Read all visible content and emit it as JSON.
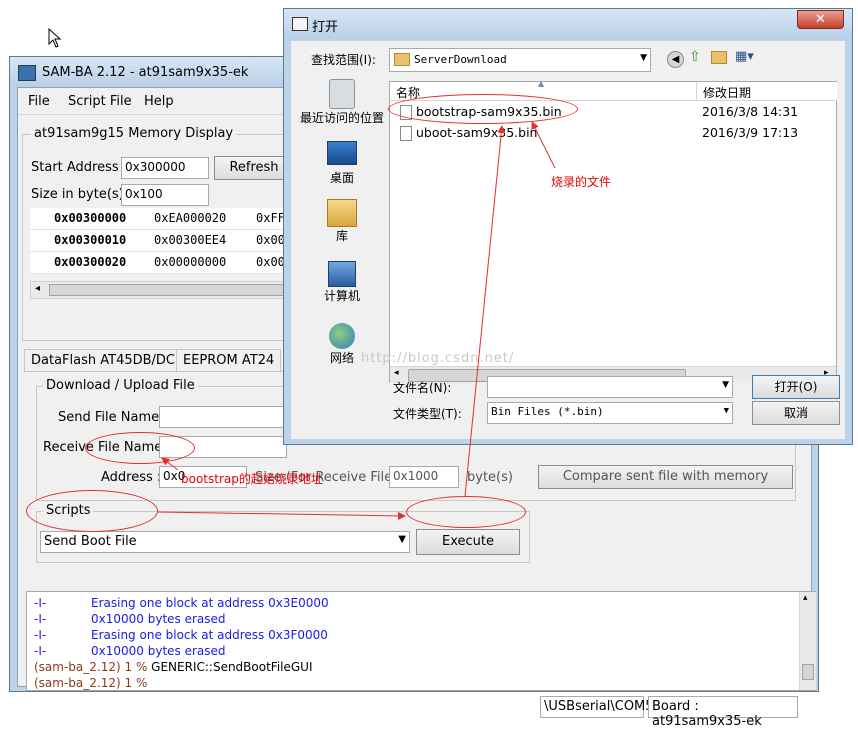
{
  "samba": {
    "title": "SAM-BA 2.12  - at91sam9x35-ek",
    "menu": [
      "File",
      "Script File",
      "Help"
    ],
    "memory_display": {
      "title": "at91sam9g15 Memory Display",
      "start_address_label": "Start Address :",
      "start_address_value": "0x300000",
      "refresh_label": "Refresh",
      "size_label": "Size in byte(s) :",
      "size_value": "0x100",
      "rows": [
        {
          "addr": "0x00300000",
          "v1": "0xEA000020",
          "v2": "0xFF"
        },
        {
          "addr": "0x00300010",
          "v1": "0x00300EE4",
          "v2": "0x00"
        },
        {
          "addr": "0x00300020",
          "v1": "0x00000000",
          "v2": "0x00"
        }
      ]
    },
    "tabs": [
      "DataFlash AT45DB/DCB",
      "EEPROM AT24"
    ],
    "download": {
      "title": "Download / Upload File",
      "send_file_label": "Send File Name :",
      "receive_file_label": "Receive File Name :",
      "address_label": "Address :",
      "address_value": "0x0",
      "size_label": "Size (For Receive File) :",
      "size_value": "0x1000",
      "size_unit": "byte(s)",
      "compare_label": "Compare sent file with memory"
    },
    "scripts": {
      "title": "Scripts",
      "selected": "Send Boot File",
      "execute_label": "Execute"
    },
    "log": [
      {
        "prefix": "-I-",
        "text": "Erasing one block at address 0x3E0000",
        "style": "blue"
      },
      {
        "prefix": "-I-",
        "text": "0x10000 bytes erased",
        "style": "blue"
      },
      {
        "prefix": "-I-",
        "text": "Erasing one block at address 0x3F0000",
        "style": "blue"
      },
      {
        "prefix": "-I-",
        "text": "0x10000 bytes erased",
        "style": "blue"
      },
      {
        "prefix": "(sam-ba_2.12) 1 %",
        "text": "GENERIC::SendBootFileGUI",
        "style": "prompt"
      },
      {
        "prefix": "(sam-ba_2.12) 1 %",
        "text": "",
        "style": "prompt"
      }
    ],
    "status": {
      "connection": "\\USBserial\\COM5",
      "board": "Board : at91sam9x35-ek"
    }
  },
  "dialog": {
    "title": "打开",
    "lookin_label": "查找范围(I):",
    "lookin_value": "ServerDownload",
    "places": [
      "最近访问的位置",
      "桌面",
      "库",
      "计算机",
      "网络"
    ],
    "columns": {
      "name": "名称",
      "date": "修改日期"
    },
    "files": [
      {
        "name": "bootstrap-sam9x35.bin",
        "date": "2016/3/8 14:31"
      },
      {
        "name": "uboot-sam9x35.bin",
        "date": "2016/3/9 17:13"
      }
    ],
    "filename_label": "文件名(N):",
    "filename_value": "",
    "filetype_label": "文件类型(T):",
    "filetype_value": "Bin Files (*.bin)",
    "open_label": "打开(O)",
    "cancel_label": "取消",
    "watermark": "http://blog.csdn.net/"
  },
  "annotations": {
    "file_note": "烧录的文件",
    "address_note": "bootstrap的起始烧录地址"
  },
  "colors": {
    "annotation": "#e60000",
    "log_blue": "#1a1ae6",
    "log_prompt": "#8b3a1a",
    "title_bar": "#b8cfe7"
  }
}
